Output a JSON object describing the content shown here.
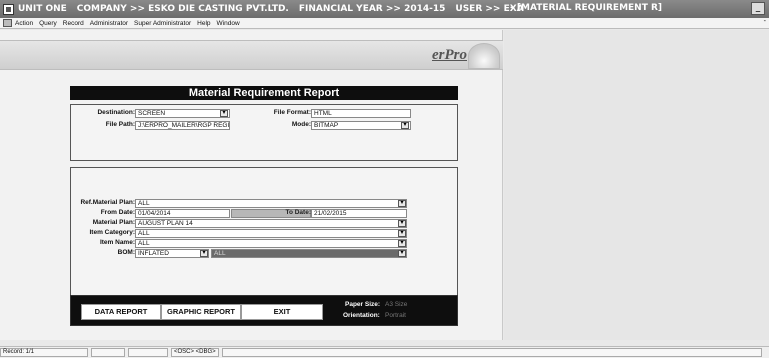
{
  "titlebar": {
    "unit": "UNIT ONE",
    "company": "COMPANY >> ESKO DIE CASTING PVT.LTD.",
    "financial_year": "FINANCIAL YEAR >> 2014-15",
    "user": "USER >> EXA",
    "form_title": "- [MATERIAL REQUIREMENT R]"
  },
  "menu": [
    "Action",
    "Query",
    "Record",
    "Administrator",
    "Super Administrator",
    "Help",
    "Window"
  ],
  "brand": "erPro",
  "report_title": "Material Requirement Report",
  "output": {
    "destination_label": "Destination:",
    "destination_value": "SCREEN",
    "file_format_label": "File Format:",
    "file_format_value": "HTML",
    "file_path_label": "File Path:",
    "file_path_value": "J:\\ERPRO_MAILER\\RGP REGI",
    "mode_label": "Mode:",
    "mode_value": "BITMAP"
  },
  "params": {
    "ref_plan_label": "Ref.Material Plan:",
    "ref_plan_value": "ALL",
    "from_date_label": "From Date:",
    "from_date_value": "01/04/2014",
    "to_date_label": "To Date:",
    "to_date_value": "21/02/2015",
    "material_plan_label": "Material Plan:",
    "material_plan_value": "AUGUST PLAN 14",
    "item_category_label": "Item Category:",
    "item_category_value": "ALL",
    "item_name_label": "Item Name:",
    "item_name_value": "ALL",
    "bom_label": "BOM:",
    "bom_value": "INFLATED",
    "bom_sub_value": "ALL"
  },
  "buttons": {
    "data_report": "DATA REPORT",
    "graphic_report": "GRAPHIC REPORT",
    "exit": "EXIT"
  },
  "paper": {
    "size_label": "Paper Size:",
    "size_value": "A3 Size",
    "orientation_label": "Orientation:",
    "orientation_value": "Portrait"
  },
  "status": {
    "record": "Record: 1/1",
    "osc_dbg": "<OSC> <DBG>"
  }
}
